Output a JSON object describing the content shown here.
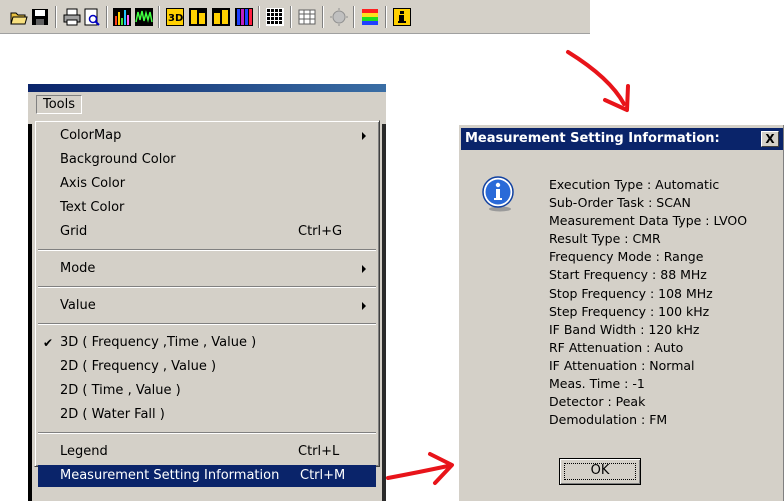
{
  "toolbar": {
    "icons": [
      "open-folder-icon",
      "save-icon",
      "print-icon",
      "print-preview-icon",
      "spectrum-icon",
      "waveform-icon",
      "3d-view-icon",
      "vf-view-icon",
      "vt-view-icon",
      "waterfall-icon",
      "grid-icon",
      "table-icon",
      "light-icon",
      "color-bar-icon",
      "info-icon"
    ]
  },
  "menubar": {
    "tools_label": "Tools"
  },
  "menu": {
    "colormap": "ColorMap",
    "background_color": "Background Color",
    "axis_color": "Axis Color",
    "text_color": "Text Color",
    "grid": "Grid",
    "grid_shortcut": "Ctrl+G",
    "mode": "Mode",
    "value": "Value",
    "check_mark": "✔",
    "view_3d": "3D ( Frequency ,Time , Value )",
    "view_2d_fv": "2D ( Frequency , Value )",
    "view_2d_tv": "2D ( Time , Value )",
    "view_2d_wf": "2D ( Water Fall )",
    "legend": "Legend",
    "legend_shortcut": "Ctrl+L",
    "measurement": "Measurement Setting Information",
    "measurement_shortcut": "Ctrl+M"
  },
  "dialog": {
    "title": "Measurement Setting Information:",
    "close_label": "X",
    "lines": [
      "Execution Type : Automatic",
      "Sub-Order Task : SCAN",
      "Measurement Data Type : LVOO",
      "Result Type : CMR",
      "Frequency Mode : Range",
      "Start Frequency : 88 MHz",
      "Stop Frequency : 108 MHz",
      "Step Frequency : 100 kHz",
      "IF Band Width : 120 kHz",
      "RF Attenuation : Auto",
      "IF Attenuation : Normal",
      "Meas. Time : -1",
      "Detector : Peak",
      "Demodulation : FM"
    ],
    "ok_label": "OK"
  },
  "colors": {
    "highlight": "#0a246a",
    "face": "#d4d0c8",
    "arrow": "#e8141a"
  }
}
